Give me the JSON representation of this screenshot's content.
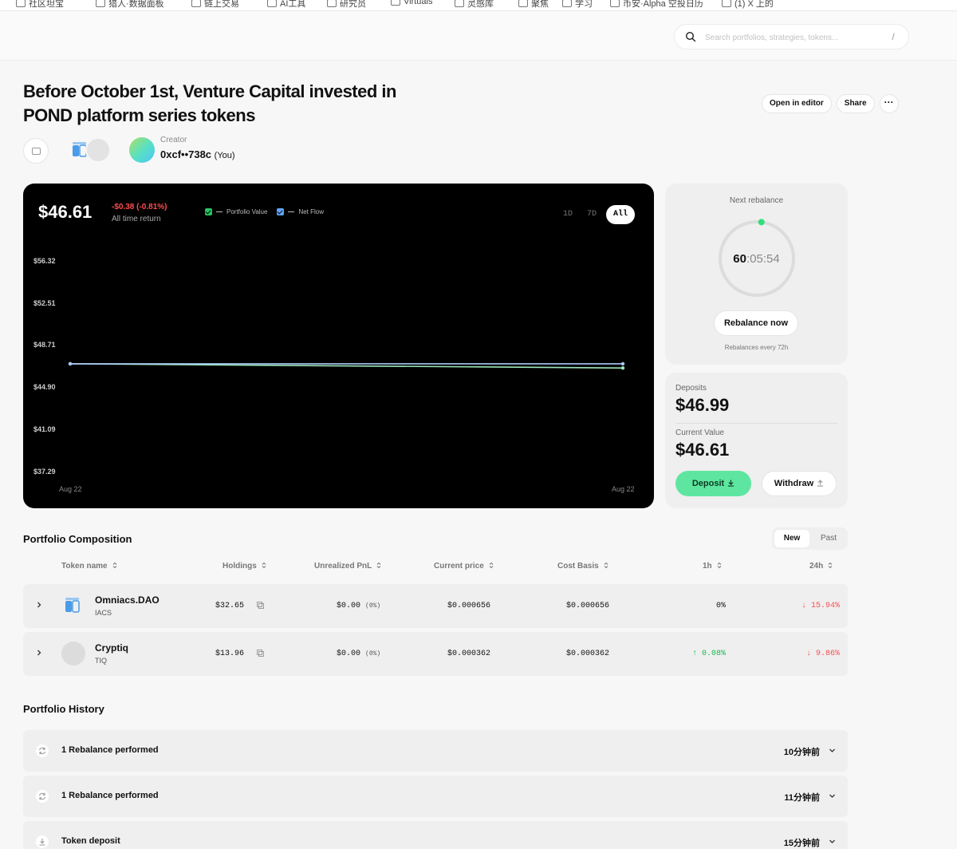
{
  "bookmarks": [
    "社区坦宝",
    "猎人·数据面板",
    "链上交易",
    "AI工具",
    "研究员",
    "Virtuals",
    "灵感库",
    "聚焦",
    "学习",
    "币安·Alpha 空投日历",
    "(1) X 上的"
  ],
  "search": {
    "placeholder": "Search portfolios, strategies, tokens...",
    "shortcut": "/"
  },
  "header": {
    "title": "Before October 1st, Venture Capital invested in POND platform series tokens",
    "open_in_editor": "Open in editor",
    "share": "Share",
    "more": "···"
  },
  "creator": {
    "label": "Creator",
    "address": "0xcf••738c",
    "you": "(You)"
  },
  "chart": {
    "value": "$46.61",
    "delta": "-$0.38 (-0.81%)",
    "return_label": "All time return",
    "legend": [
      {
        "label": "Portfolio Value",
        "color": "#22c55e"
      },
      {
        "label": "Net Flow",
        "color": "#60a5fa"
      }
    ],
    "ranges": [
      "1D",
      "7D",
      "All"
    ],
    "active_range": "All"
  },
  "chart_data": {
    "type": "line",
    "x": [
      "Aug 22",
      "Aug 22"
    ],
    "yticks": [
      "$56.32",
      "$52.51",
      "$48.71",
      "$44.90",
      "$41.09",
      "$37.29"
    ],
    "ylim": [
      37.29,
      56.32
    ],
    "series": [
      {
        "name": "Portfolio Value",
        "values": [
          46.99,
          46.61
        ],
        "color": "#9be7b8"
      },
      {
        "name": "Net Flow",
        "values": [
          46.99,
          46.99
        ],
        "color": "#a9c8f5"
      }
    ]
  },
  "rebalance": {
    "label": "Next rebalance",
    "timer_main": "60",
    "timer_rest": ":05:54",
    "progress": 0.02,
    "button": "Rebalance now",
    "every": "Rebalances every 72h"
  },
  "deposits": {
    "deposits_label": "Deposits",
    "deposits_value": "$46.99",
    "current_label": "Current Value",
    "current_value": "$46.61",
    "deposit_btn": "Deposit",
    "withdraw_btn": "Withdraw"
  },
  "composition": {
    "title": "Portfolio Composition",
    "toggle": [
      "New",
      "Past"
    ],
    "columns": [
      "Token name",
      "Holdings",
      "Unrealized PnL",
      "Current price",
      "Cost Basis",
      "1h",
      "24h"
    ],
    "rows": [
      {
        "name": "Omniacs.DAO",
        "symbol": "IACS",
        "holdings": "$32.65",
        "pnl": "$0.00",
        "pnl_pct": "(0%)",
        "price": "$0.000656",
        "cost": "$0.000656",
        "h1": "0%",
        "h24": "↓ 15.94%"
      },
      {
        "name": "Cryptiq",
        "symbol": "TIQ",
        "holdings": "$13.96",
        "pnl": "$0.00",
        "pnl_pct": "(0%)",
        "price": "$0.000362",
        "cost": "$0.000362",
        "h1": "↑ 0.08%",
        "h24": "↓ 9.86%"
      }
    ]
  },
  "history": {
    "title": "Portfolio History",
    "rows": [
      {
        "label": "1 Rebalance performed",
        "time": "10分钟前"
      },
      {
        "label": "1 Rebalance performed",
        "time": "11分钟前"
      },
      {
        "label": "Token deposit",
        "time": "15分钟前"
      }
    ]
  }
}
